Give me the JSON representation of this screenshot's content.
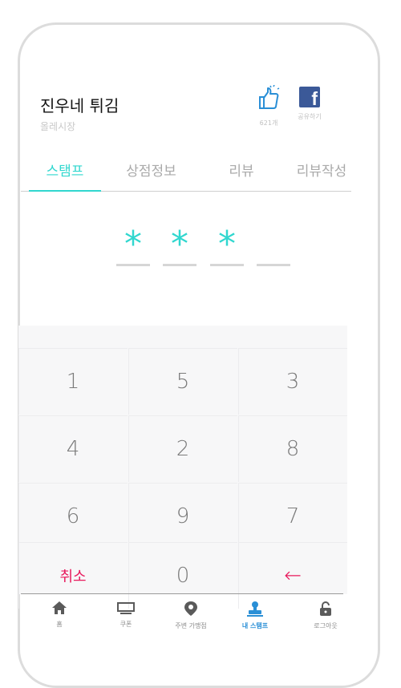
{
  "store": {
    "name": "진우네 튀김",
    "market": "올레시장"
  },
  "actions": {
    "like": {
      "count": "621개"
    },
    "share": {
      "label": "공유하기"
    }
  },
  "tabs": [
    {
      "label": "스탬프",
      "active": true
    },
    {
      "label": "상점정보",
      "active": false
    },
    {
      "label": "리뷰",
      "active": false
    },
    {
      "label": "리뷰작성",
      "active": false
    }
  ],
  "pin": {
    "slots": [
      "*",
      "*",
      "*",
      ""
    ]
  },
  "keypad": {
    "keys": [
      "1",
      "5",
      "3",
      "4",
      "2",
      "8",
      "6",
      "9",
      "7",
      "취소",
      "0",
      "←"
    ]
  },
  "nav": [
    {
      "label": "홈",
      "icon": "home-icon"
    },
    {
      "label": "쿠폰",
      "icon": "coupon-icon"
    },
    {
      "label": "주변 가맹점",
      "icon": "location-pin-icon"
    },
    {
      "label": "내 스탬프",
      "icon": "stamp-icon",
      "active": true
    },
    {
      "label": "로그아웃",
      "icon": "lock-icon"
    }
  ],
  "colors": {
    "accent": "#31d7cf",
    "danger": "#e8185c",
    "facebook": "#3b5998",
    "navActive": "#2a8fd6"
  }
}
